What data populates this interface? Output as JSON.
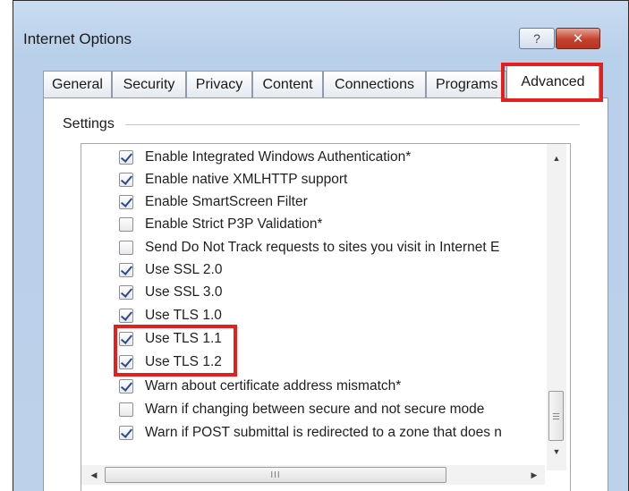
{
  "window": {
    "title": "Internet Options",
    "help_glyph": "?",
    "close_glyph": "✕"
  },
  "tabs": [
    {
      "label": "General"
    },
    {
      "label": "Security"
    },
    {
      "label": "Privacy"
    },
    {
      "label": "Content"
    },
    {
      "label": "Connections"
    },
    {
      "label": "Programs"
    },
    {
      "label": "Advanced",
      "active": true
    }
  ],
  "settings": {
    "group_label": "Settings",
    "items": [
      {
        "label": "Enable Integrated Windows Authentication*",
        "checked": true
      },
      {
        "label": "Enable native XMLHTTP support",
        "checked": true
      },
      {
        "label": "Enable SmartScreen Filter",
        "checked": true
      },
      {
        "label": "Enable Strict P3P Validation*",
        "checked": false
      },
      {
        "label": "Send Do Not Track requests to sites you visit in Internet E",
        "checked": false
      },
      {
        "label": "Use SSL 2.0",
        "checked": true
      },
      {
        "label": "Use SSL 3.0",
        "checked": true
      },
      {
        "label": "Use TLS 1.0",
        "checked": true
      },
      {
        "label": "Use TLS 1.1",
        "checked": true
      },
      {
        "label": "Use TLS 1.2",
        "checked": true
      },
      {
        "label": "Warn about certificate address mismatch*",
        "checked": true
      },
      {
        "label": "Warn if changing between secure and not secure mode",
        "checked": false
      },
      {
        "label": "Warn if POST submittal is redirected to a zone that does n",
        "checked": true
      }
    ]
  },
  "scrollbars": {
    "up_arrow": "▲",
    "down_arrow": "▼",
    "left_arrow": "◀",
    "right_arrow": "▶",
    "hgrip": "III"
  },
  "colors": {
    "highlight": "#e51e1e",
    "check": "#2c4b86"
  }
}
